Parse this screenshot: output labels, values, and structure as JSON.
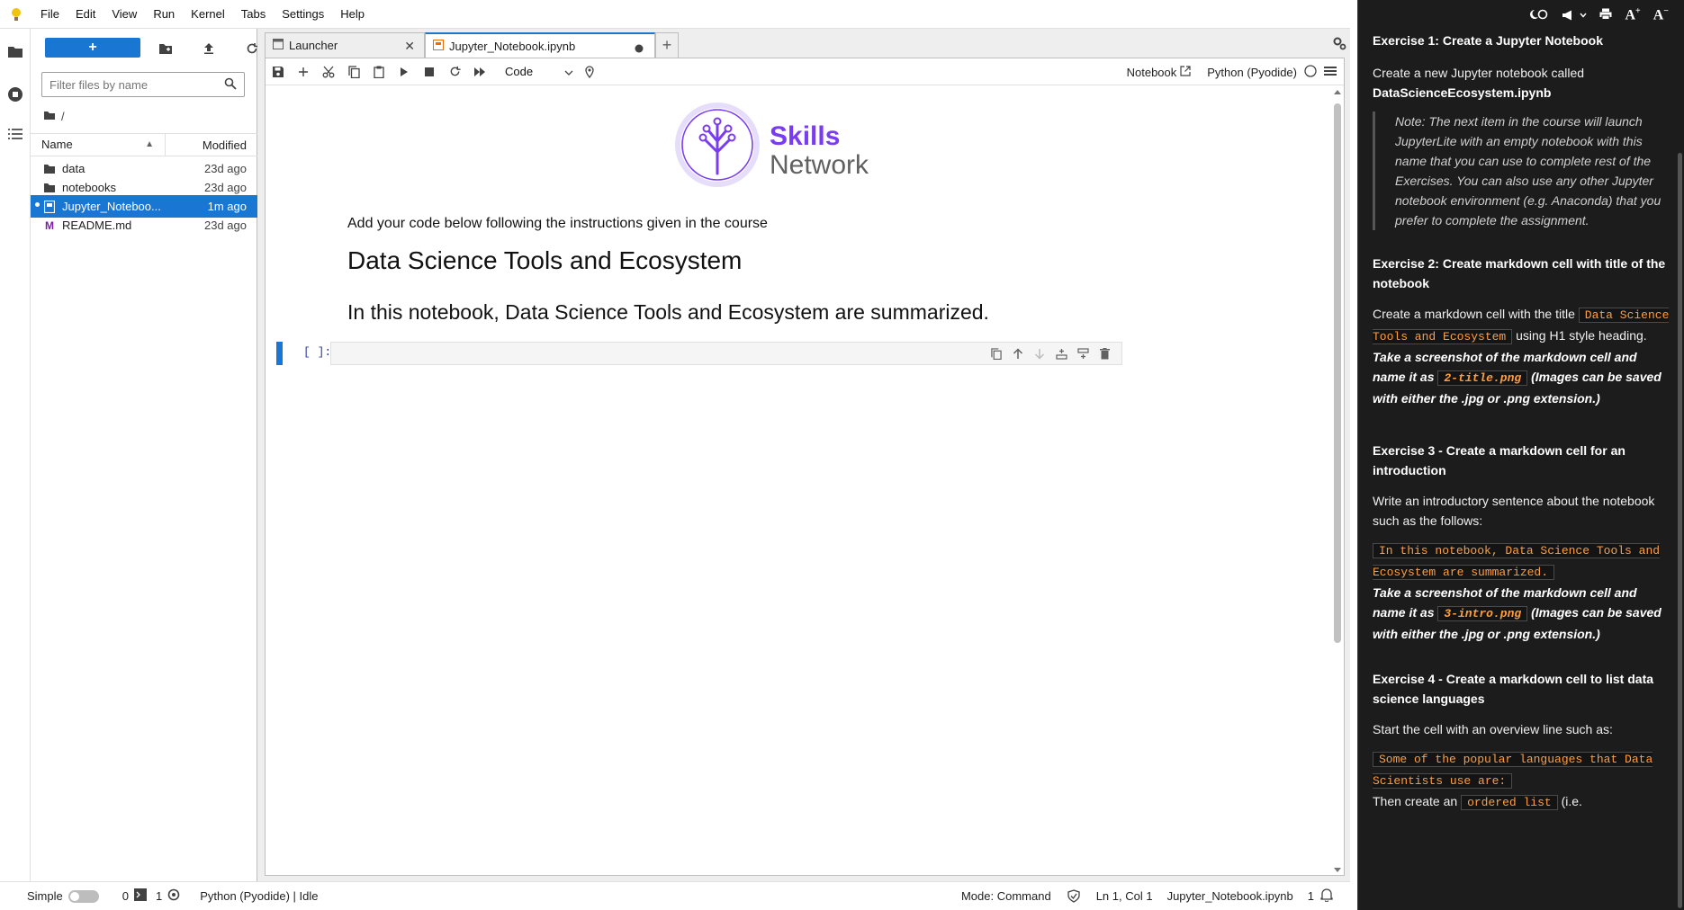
{
  "menubar": {
    "items": [
      "File",
      "Edit",
      "View",
      "Run",
      "Kernel",
      "Tabs",
      "Settings",
      "Help"
    ]
  },
  "filebrowser": {
    "new_label": "+",
    "filter_placeholder": "Filter files by name",
    "breadcrumb": "/",
    "header": {
      "name": "Name",
      "modified": "Modified"
    },
    "rows": [
      {
        "name": "data",
        "modified": "23d ago",
        "type": "folder"
      },
      {
        "name": "notebooks",
        "modified": "23d ago",
        "type": "folder"
      },
      {
        "name": "Jupyter_Noteboo...",
        "modified": "1m ago",
        "type": "notebook",
        "selected": true
      },
      {
        "name": "README.md",
        "modified": "23d ago",
        "type": "markdown"
      }
    ]
  },
  "tabs": [
    {
      "label": "Launcher",
      "active": false
    },
    {
      "label": "Jupyter_Notebook.ipynb",
      "active": true
    }
  ],
  "notebook_toolbar": {
    "cell_type": "Code",
    "notebook_label": "Notebook",
    "kernel_label": "Python (Pyodide)"
  },
  "notebook": {
    "logo": {
      "line1": "Skills",
      "line2": "Network"
    },
    "intro_text": "Add your code below following the instructions given in the course",
    "h1": "Data Science Tools and Ecosystem",
    "h2": "In this notebook, Data Science Tools and Ecosystem are summarized.",
    "cell_prompt": "[ ]:"
  },
  "statusbar": {
    "mode_label": "Simple",
    "terminals": "0",
    "kernels": "1",
    "kernel_status": "Python (Pyodide) | Idle",
    "command_mode": "Mode: Command",
    "cursor": "Ln 1, Col 1",
    "filename": "Jupyter_Notebook.ipynb",
    "notifications": "1"
  },
  "instructions": {
    "ex1_title": "Exercise 1: Create a Jupyter Notebook",
    "ex1_text": "Create a new Jupyter notebook called",
    "ex1_name": "DataScienceEcosystem.ipynb",
    "ex1_note": "Note: The next item in the course will launch JupyterLite with an empty notebook with this name that you can use to complete rest of the Exercises. You can also use any other Jupyter notebook environment (e.g. Anaconda) that you prefer to complete the assignment.",
    "ex2_title": "Exercise 2: Create markdown cell with title of the notebook",
    "ex2_text_a": "Create a markdown cell with the title",
    "ex2_code": "Data Science Tools and Ecosystem",
    "ex2_text_b": "using H1 style heading.",
    "ex2_bi_a": "Take a screenshot of the markdown cell and name it as",
    "ex2_file": "2-title.png",
    "ex2_bi_b": "(Images can be saved with either the .jpg or .png extension.)",
    "ex3_title": "Exercise 3 - Create a markdown cell for an introduction",
    "ex3_text": "Write an introductory sentence about the notebook such as the follows:",
    "ex3_code": "In this notebook, Data Science Tools and Ecosystem are summarized.",
    "ex3_bi_a": "Take a screenshot of the markdown cell and name it as",
    "ex3_file": "3-intro.png",
    "ex3_bi_b": "(Images can be saved with either the .jpg or .png extension.)",
    "ex4_title": "Exercise 4 - Create a markdown cell to list data science languages",
    "ex4_text": "Start the cell with an overview line such as:",
    "ex4_code": "Some of the popular languages that Data Scientists use are:",
    "ex4_text_b": "Then create an",
    "ex4_code_b": "ordered list",
    "ex4_text_c": "(i.e."
  },
  "colors": {
    "accent": "#1976d2",
    "brand_purple": "#7a3cf0",
    "code_orange": "#ff9e3d",
    "instr_bg": "#1c1c1c"
  }
}
